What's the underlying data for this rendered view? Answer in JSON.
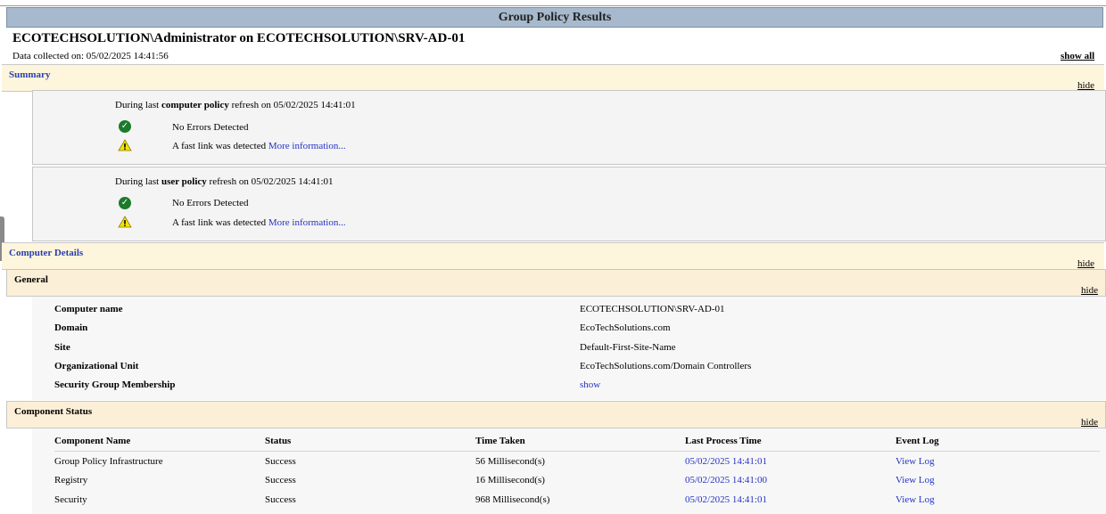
{
  "header": {
    "title": "Group Policy Results",
    "heading": "ECOTECHSOLUTION\\Administrator on ECOTECHSOLUTION\\SRV-AD-01",
    "collected": "Data collected on: 05/02/2025 14:41:56",
    "show_all": "show all"
  },
  "summary": {
    "title": "Summary",
    "hide": "hide",
    "computer": {
      "prefix": "During last ",
      "bold": "computer policy",
      "suffix": " refresh on 05/02/2025 14:41:01",
      "ok_text": "No Errors Detected",
      "warn_text": "A fast link was detected ",
      "more": "More information..."
    },
    "user": {
      "prefix": "During last ",
      "bold": "user policy",
      "suffix": " refresh on 05/02/2025 14:41:01",
      "ok_text": "No Errors Detected",
      "warn_text": "A fast link was detected ",
      "more": "More information..."
    }
  },
  "computer_details": {
    "title": "Computer Details",
    "hide": "hide",
    "general": {
      "title": "General",
      "hide": "hide",
      "rows": [
        {
          "label": "Computer name",
          "value": "ECOTECHSOLUTION\\SRV-AD-01"
        },
        {
          "label": "Domain",
          "value": "EcoTechSolutions.com"
        },
        {
          "label": "Site",
          "value": "Default-First-Site-Name"
        },
        {
          "label": "Organizational Unit",
          "value": "EcoTechSolutions.com/Domain Controllers"
        },
        {
          "label": "Security Group Membership",
          "value": "show"
        }
      ]
    },
    "component_status": {
      "title": "Component Status",
      "hide": "hide",
      "columns": [
        "Component Name",
        "Status",
        "Time Taken",
        "Last Process Time",
        "Event Log"
      ],
      "rows": [
        {
          "name": "Group Policy Infrastructure",
          "status": "Success",
          "time": "56 Millisecond(s)",
          "last": "05/02/2025 14:41:01",
          "log": "View Log"
        },
        {
          "name": "Registry",
          "status": "Success",
          "time": "16 Millisecond(s)",
          "last": "05/02/2025 14:41:00",
          "log": "View Log"
        },
        {
          "name": "Security",
          "status": "Success",
          "time": "968 Millisecond(s)",
          "last": "05/02/2025 14:41:01",
          "log": "View Log"
        }
      ]
    }
  },
  "colors": {
    "titlebar": "#a7b9cd",
    "section_bg": "#fef5dd",
    "link": "#2433c7",
    "success": "#1c7a2a",
    "warning": "#f2e500"
  },
  "icons": {
    "ok": "check-circle-icon",
    "warn": "warning-triangle-icon"
  }
}
